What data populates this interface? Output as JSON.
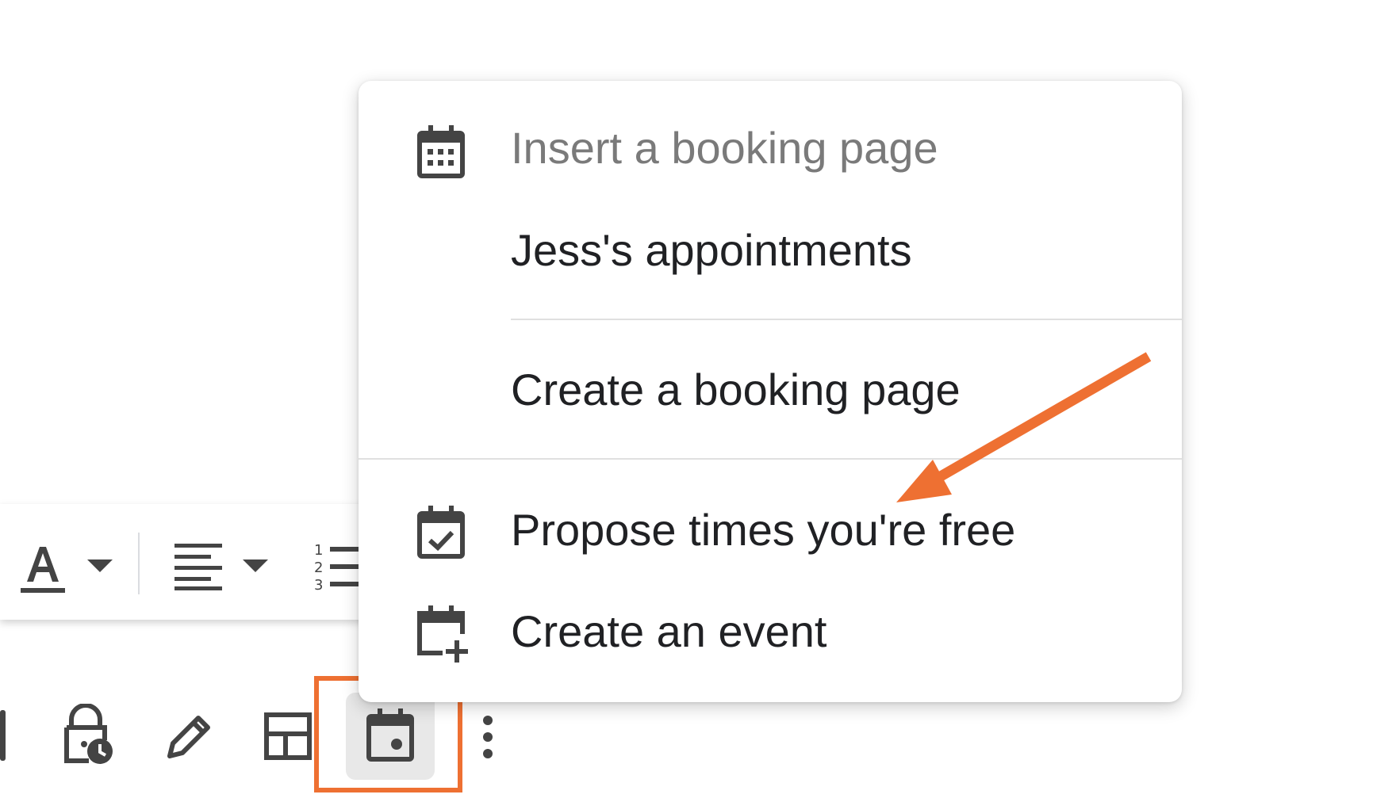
{
  "menu": {
    "header_label": "Insert a booking page",
    "items": [
      {
        "label": "Jess's appointments"
      },
      {
        "label": "Create a booking page"
      },
      {
        "label": "Propose times you're free"
      },
      {
        "label": "Create an event"
      }
    ],
    "icons": {
      "header": "calendar-grid-icon",
      "propose": "calendar-check-icon",
      "create_event": "calendar-add-icon"
    }
  },
  "formatting_toolbar": {
    "icons": [
      "text-color-icon",
      "dropdown-arrow-icon",
      "align-icon",
      "dropdown-arrow-icon",
      "numbered-list-icon"
    ]
  },
  "compose_toolbar": {
    "icons": [
      "insert-photo-icon",
      "confidential-mode-icon",
      "signature-icon",
      "layouts-icon",
      "schedule-icon",
      "more-options-icon"
    ]
  },
  "annotation": {
    "color": "#ee7032"
  }
}
